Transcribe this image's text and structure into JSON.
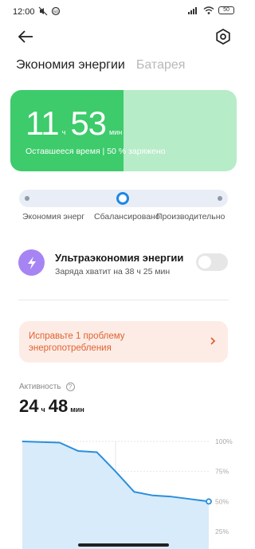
{
  "status_bar": {
    "time": "12:00",
    "battery": "50",
    "icons": [
      "mute-icon",
      "sync-icon",
      "signal-icon",
      "wifi-icon",
      "battery-icon"
    ]
  },
  "header": {
    "back_icon": "back-arrow-icon",
    "settings_icon": "gear-icon"
  },
  "tabs": [
    {
      "label": "Экономия энергии",
      "active": true
    },
    {
      "label": "Батарея",
      "active": false
    }
  ],
  "battery_card": {
    "hours": "11",
    "hours_unit": "ч",
    "minutes": "53",
    "minutes_unit": "мин",
    "subtitle": "Оставшееся время | 50 % заряжено",
    "charge_fraction": 0.5,
    "colors": {
      "fill": "#3dcb6b",
      "empty": "#b6ecc7"
    }
  },
  "power_mode": {
    "options": [
      "Экономия энергии",
      "Сбалансировано",
      "Производительность"
    ],
    "visible_labels": [
      "Экономия энерг",
      "Сбалансировано",
      "Производительность"
    ],
    "selected_index": 1,
    "accent": "#1e88e5"
  },
  "ultra_saver": {
    "icon": "lightning-icon",
    "title": "Ультраэкономия энергии",
    "subtitle": "Заряда хватит на 38 ч 25 мин",
    "enabled": false
  },
  "fix_banner": {
    "text": "Исправьте 1 проблему энергопотребления",
    "chevron": "chevron-right-icon",
    "color": "#e0622f"
  },
  "activity": {
    "label": "Активность",
    "help_icon": "question-icon",
    "hours": "24",
    "hours_unit": "ч",
    "minutes": "48",
    "minutes_unit": "мин"
  },
  "chart_data": {
    "type": "area",
    "y_ticks": [
      "100%",
      "75%",
      "50%",
      "25%"
    ],
    "ylim": [
      25,
      100
    ],
    "x": [
      0,
      1,
      2,
      3,
      4,
      5,
      6,
      7,
      8,
      9,
      10
    ],
    "values": [
      100,
      99.5,
      99,
      92,
      91,
      75,
      58,
      55,
      54,
      52,
      50
    ],
    "grid": true,
    "line_color": "#2a8fdc",
    "fill_color": "#d8ebfa"
  }
}
